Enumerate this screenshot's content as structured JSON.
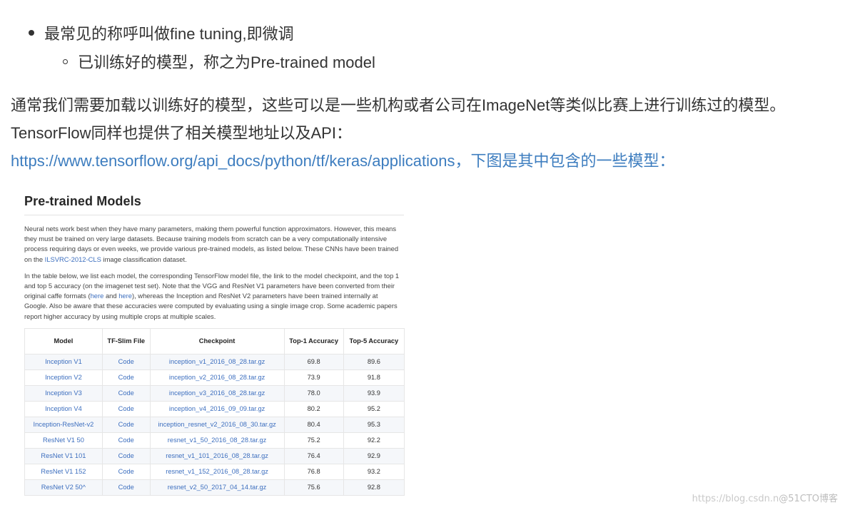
{
  "bullets": {
    "item1": "最常见的称呼叫做fine tuning,即微调",
    "item2": "已训练好的模型，称之为Pre-trained model"
  },
  "paragraph": {
    "text1": "通常我们需要加载以训练好的模型，这些可以是一些机构或者公司在ImageNet等类似比赛上进行训练过的模型。TensorFlow同样也提供了相关模型地址以及API：",
    "link": "https://www.tensorflow.org/api_docs/python/tf/keras/applications",
    "text2": "，下图是其中包含的一些模型："
  },
  "embed": {
    "title": "Pre-trained Models",
    "p1_a": "Neural nets work best when they have many parameters, making them powerful function approximators. However, this means they must be trained on very large datasets. Because training models from scratch can be a very computationally intensive process requiring days or even weeks, we provide various pre-trained models, as listed below. These CNNs have been trained on the ",
    "p1_link": "ILSVRC-2012-CLS",
    "p1_b": " image classification dataset.",
    "p2_a": "In the table below, we list each model, the corresponding TensorFlow model file, the link to the model checkpoint, and the top 1 and top 5 accuracy (on the imagenet test set). Note that the VGG and ResNet V1 parameters have been converted from their original caffe formats (",
    "p2_link1": "here",
    "p2_and": " and ",
    "p2_link2": "here",
    "p2_b": "), whereas the Inception and ResNet V2 parameters have been trained internally at Google. Also be aware that these accuracies were computed by evaluating using a single image crop. Some academic papers report higher accuracy by using multiple crops at multiple scales.",
    "table": {
      "headers": {
        "model": "Model",
        "file": "TF-Slim File",
        "checkpoint": "Checkpoint",
        "top1": "Top-1 Accuracy",
        "top5": "Top-5 Accuracy"
      },
      "rows": [
        {
          "model": "Inception V1",
          "file": "Code",
          "checkpoint": "inception_v1_2016_08_28.tar.gz",
          "top1": "69.8",
          "top5": "89.6"
        },
        {
          "model": "Inception V2",
          "file": "Code",
          "checkpoint": "inception_v2_2016_08_28.tar.gz",
          "top1": "73.9",
          "top5": "91.8"
        },
        {
          "model": "Inception V3",
          "file": "Code",
          "checkpoint": "inception_v3_2016_08_28.tar.gz",
          "top1": "78.0",
          "top5": "93.9"
        },
        {
          "model": "Inception V4",
          "file": "Code",
          "checkpoint": "inception_v4_2016_09_09.tar.gz",
          "top1": "80.2",
          "top5": "95.2"
        },
        {
          "model": "Inception-ResNet-v2",
          "file": "Code",
          "checkpoint": "inception_resnet_v2_2016_08_30.tar.gz",
          "top1": "80.4",
          "top5": "95.3"
        },
        {
          "model": "ResNet V1 50",
          "file": "Code",
          "checkpoint": "resnet_v1_50_2016_08_28.tar.gz",
          "top1": "75.2",
          "top5": "92.2"
        },
        {
          "model": "ResNet V1 101",
          "file": "Code",
          "checkpoint": "resnet_v1_101_2016_08_28.tar.gz",
          "top1": "76.4",
          "top5": "92.9"
        },
        {
          "model": "ResNet V1 152",
          "file": "Code",
          "checkpoint": "resnet_v1_152_2016_08_28.tar.gz",
          "top1": "76.8",
          "top5": "93.2"
        },
        {
          "model": "ResNet V2 50^",
          "file": "Code",
          "checkpoint": "resnet_v2_50_2017_04_14.tar.gz",
          "top1": "75.6",
          "top5": "92.8"
        }
      ]
    }
  },
  "watermark": {
    "url": "https://blog.csdn.n",
    "brand": "@51CTO博客"
  }
}
